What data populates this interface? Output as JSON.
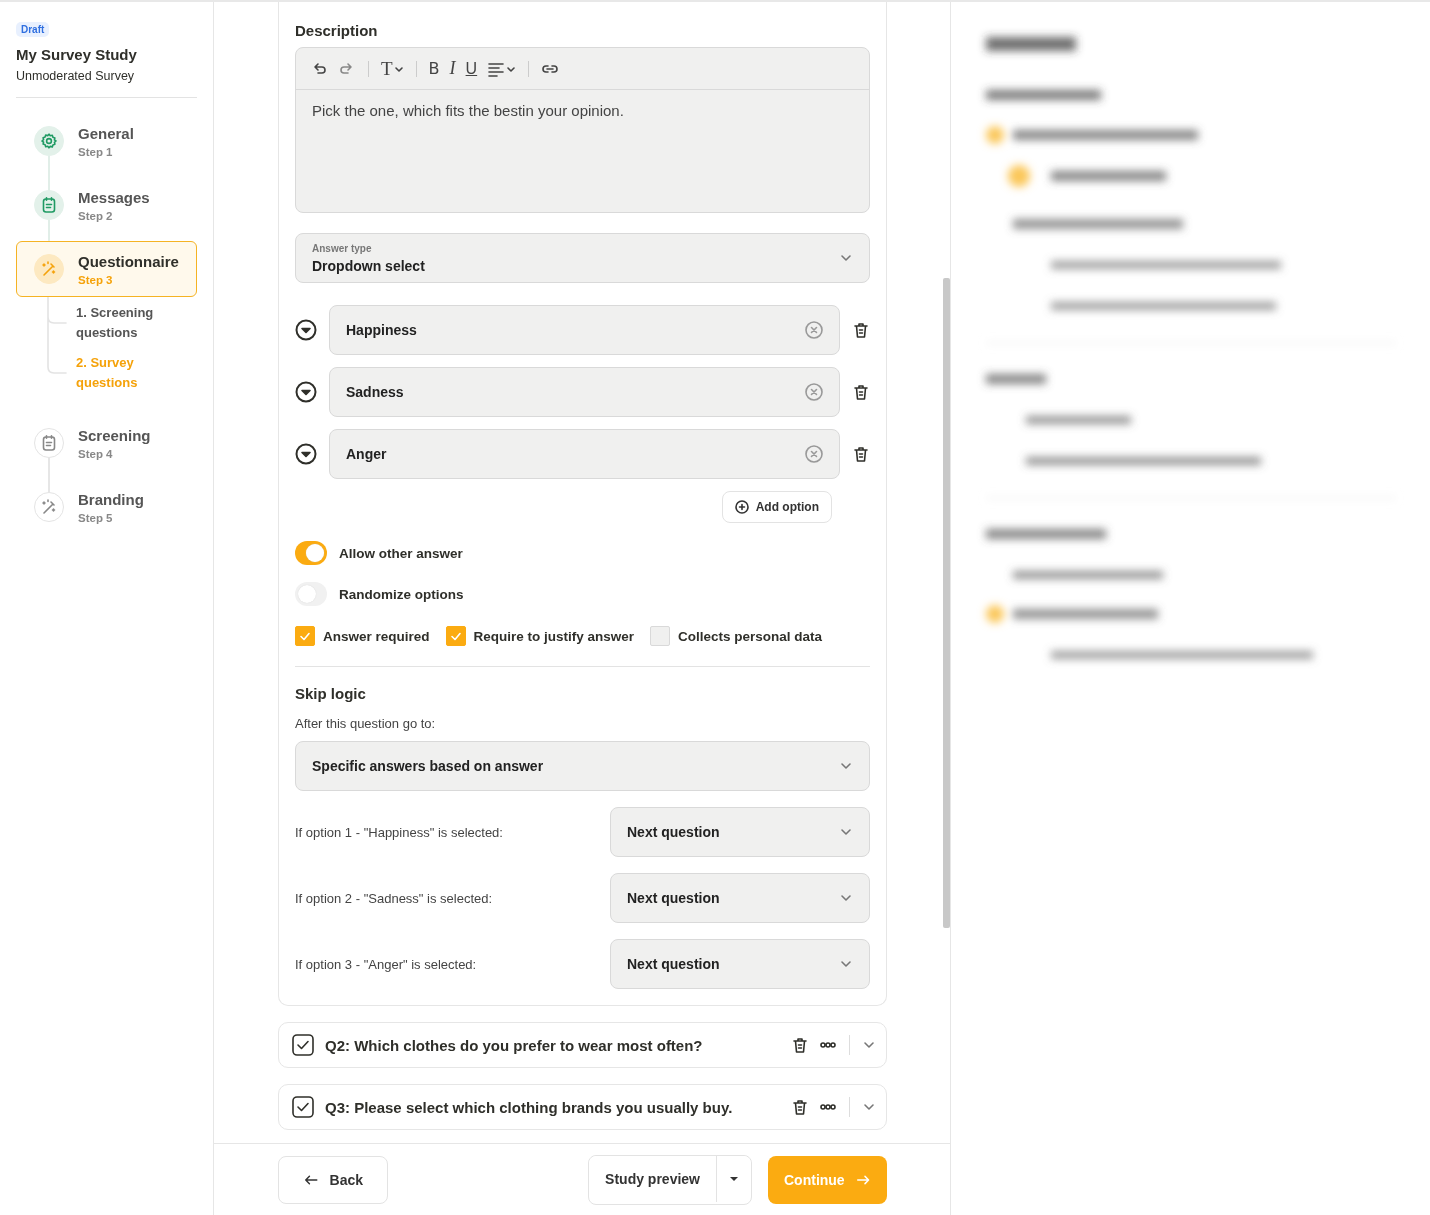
{
  "study": {
    "badge": "Draft",
    "title": "My Survey Study",
    "subtitle": "Unmoderated Survey"
  },
  "steps": [
    {
      "kind": "gear",
      "title": "General",
      "step": "Step 1",
      "completed": true,
      "selected": false
    },
    {
      "kind": "clipboard",
      "title": "Messages",
      "step": "Step 2",
      "completed": true,
      "selected": false
    },
    {
      "kind": "wand",
      "title": "Questionnaire",
      "step": "Step 3",
      "completed": false,
      "selected": true,
      "children": [
        {
          "label": "1. Screening questions",
          "selected": false
        },
        {
          "label": "2. Survey questions",
          "selected": true
        }
      ]
    },
    {
      "kind": "clipboard",
      "title": "Screening",
      "step": "Step 4",
      "completed": false,
      "selected": false
    },
    {
      "kind": "wand",
      "title": "Branding",
      "step": "Step 5",
      "completed": false,
      "selected": false
    }
  ],
  "editor": {
    "label": "Description",
    "toolbar": {
      "heading": "T",
      "bold": "B",
      "italic": "I",
      "underline": "U"
    },
    "text": "Pick the one, which fits the bestin your opinion."
  },
  "answer_type": {
    "label": "Answer type",
    "value": "Dropdown select"
  },
  "options": [
    {
      "value": "Happiness"
    },
    {
      "value": "Sadness"
    },
    {
      "value": "Anger"
    }
  ],
  "add_option": "Add option",
  "toggles": [
    {
      "label": "Allow other answer",
      "on": true
    },
    {
      "label": "Randomize options",
      "on": false
    }
  ],
  "checkboxes": [
    {
      "label": "Answer required",
      "checked": true
    },
    {
      "label": "Require to justify answer",
      "checked": true
    },
    {
      "label": "Collects personal data",
      "checked": false
    }
  ],
  "skip_logic": {
    "title": "Skip logic",
    "prompt": "After this question go to:",
    "mode": "Specific answers based on answer",
    "rules": [
      {
        "condition": "If option 1 - \"Happiness\" is selected:",
        "target": "Next question"
      },
      {
        "condition": "If option 2 - \"Sadness\" is selected:",
        "target": "Next question"
      },
      {
        "condition": "If option 3 - \"Anger\" is selected:",
        "target": "Next question"
      }
    ]
  },
  "questions": [
    {
      "title": "Q2: Which clothes do you prefer to wear most often?",
      "checked": true
    },
    {
      "title": "Q3: Please select which clothing brands you usually buy.",
      "checked": true
    }
  ],
  "footer": {
    "back": "Back",
    "preview": "Study preview",
    "continue": "Continue"
  }
}
